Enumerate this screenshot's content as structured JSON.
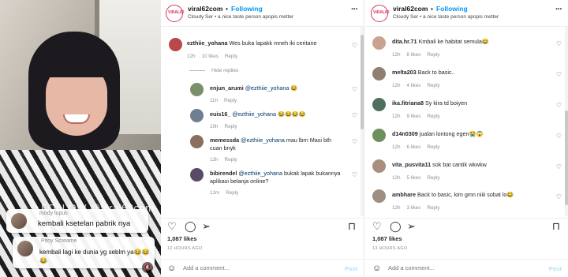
{
  "media": {
    "watermark": "FOLLOW @viral62com",
    "overlay_comments": [
      {
        "user": "mody lupus",
        "text": "kembali ksetelan pabrik nya"
      },
      {
        "user": "Pitoy Screame",
        "text": "kembali lagi ke dunia yg seblm ya😂😂😂"
      }
    ]
  },
  "panels": [
    {
      "header": {
        "avatar_text": "VIRAL62",
        "username": "viral62com",
        "dot": "•",
        "follow": "Following",
        "subtitle": "Cloudy Ser • a nice taste person apopis metter",
        "more": "···"
      },
      "comments": [
        {
          "user": "ezthiie_yohana",
          "text": "Wes buka lapakk mneh iki ceritane",
          "time": "12h",
          "likes": "10 likes",
          "reply": "Reply",
          "color": "#b9484a"
        },
        {
          "hide_replies": "Hide replies"
        },
        {
          "user": "enjun_arumi",
          "mention": "@ezthiie_yohana",
          "text": "😂",
          "time": "11h",
          "likes": "",
          "reply": "Reply",
          "color": "#7a8f6a"
        },
        {
          "user": "euis16_",
          "mention": "@ezthiie_yohana",
          "text": "😂😂😂😂",
          "time": "10h",
          "likes": "",
          "reply": "Reply",
          "color": "#6f7f8f"
        },
        {
          "user": "memessda",
          "mention": "@ezthiie_yohana",
          "text": "mau lbrn Masi bth cuan bnyk",
          "time": "12h",
          "likes": "",
          "reply": "Reply",
          "color": "#8a6f5f"
        },
        {
          "user": "bibirendel",
          "mention": "@ezthiie_yohana",
          "text": "bukak lapak bukannya aplikasi belanja online?",
          "time": "12m",
          "likes": "",
          "reply": "Reply",
          "color": "#5a4a6a"
        }
      ],
      "likes": "1,087 likes",
      "ago": "12 HOURS AGO",
      "add_comment_placeholder": "Add a comment...",
      "post": "Post"
    },
    {
      "header": {
        "avatar_text": "VIRAL62",
        "username": "viral62com",
        "dot": "•",
        "follow": "Following",
        "subtitle": "Cloudy Ser • a nice taste person apopis metter",
        "more": "···"
      },
      "comments": [
        {
          "user": "dita.hr.71",
          "text": "Kmbali ke habitat semula😂",
          "time": "12h",
          "likes": "8 likes",
          "reply": "Reply",
          "color": "#c9a38f"
        },
        {
          "user": "melta203",
          "text": "Back to basic..",
          "time": "12h",
          "likes": "4 likes",
          "reply": "Reply",
          "color": "#8f7f70"
        },
        {
          "user": "ika.fitriana8",
          "text": "Sy kira td boiyen",
          "time": "12h",
          "likes": "9 likes",
          "reply": "Reply",
          "color": "#4f6f5f"
        },
        {
          "user": "d14n0309",
          "text": "jualan lontong egen😭😱",
          "time": "12h",
          "likes": "6 likes",
          "reply": "Reply",
          "color": "#6f8f5f"
        },
        {
          "user": "vita_pusvita11",
          "text": "sok bat cantik wkwkw",
          "time": "12h",
          "likes": "5 likes",
          "reply": "Reply",
          "color": "#a88f7f"
        },
        {
          "user": "ambhare",
          "text": "Back to basic, kim gmn niiii sobat lo😂",
          "time": "12h",
          "likes": "3 likes",
          "reply": "Reply",
          "color": "#9f8f80"
        }
      ],
      "likes": "1,087 likes",
      "ago": "13 HOURS AGO",
      "add_comment_placeholder": "Add a comment...",
      "post": "Post"
    }
  ],
  "icons": {
    "heart": "♡",
    "comment": "◯",
    "share": "➢",
    "bookmark": "⊓",
    "emoji": "☺",
    "sound": "🔇"
  }
}
